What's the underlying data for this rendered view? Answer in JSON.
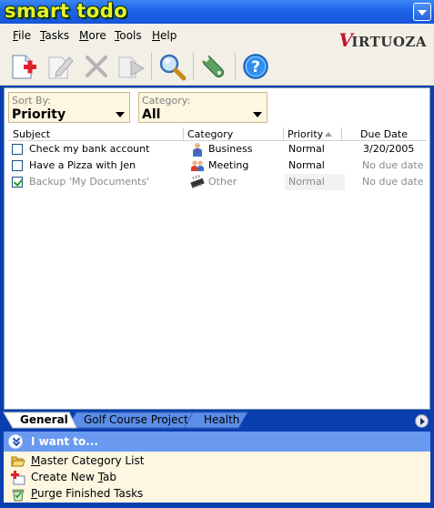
{
  "app": {
    "logo_text": "smart todo",
    "brand": "Virtuoza"
  },
  "menu": [
    {
      "label": "File",
      "mnemonic": "F",
      "rest": "ile"
    },
    {
      "label": "Tasks",
      "mnemonic": "T",
      "rest": "asks"
    },
    {
      "label": "More",
      "mnemonic": "M",
      "rest": "ore"
    },
    {
      "label": "Tools",
      "mnemonic": "T",
      "rest": "ools"
    },
    {
      "label": "Help",
      "mnemonic": "H",
      "rest": "elp"
    }
  ],
  "toolbar": {
    "icons": [
      "new-task-icon",
      "edit-task-icon",
      "delete-task-icon",
      "forward-task-icon",
      "search-icon",
      "tools-icon",
      "help-icon"
    ]
  },
  "filters": {
    "sort_by": {
      "label": "Sort By:",
      "value": "Priority"
    },
    "category": {
      "label": "Category:",
      "value": "All"
    }
  },
  "table": {
    "columns": [
      "Subject",
      "Category",
      "Priority",
      "Due Date"
    ],
    "rows": [
      {
        "checked": false,
        "subject": "Check my bank account",
        "category": "Business",
        "category_icon": "business-person-icon",
        "priority": "Normal",
        "due_date": "3/20/2005",
        "done": false
      },
      {
        "checked": false,
        "subject": "Have a Pizza with Jen",
        "category": "Meeting",
        "category_icon": "meeting-people-icon",
        "priority": "Normal",
        "due_date": "No due date",
        "done": false
      },
      {
        "checked": true,
        "subject": "Backup 'My Documents'",
        "category": "Other",
        "category_icon": "chip-icon",
        "priority": "Normal",
        "due_date": "No due date",
        "done": true
      }
    ]
  },
  "tabs": [
    {
      "label": "General",
      "active": true
    },
    {
      "label": "Golf Course Project",
      "active": false
    },
    {
      "label": "Health",
      "active": false
    }
  ],
  "iwant": {
    "title": "I want to...",
    "actions": [
      {
        "label": "Master Category List",
        "icon": "folder-open-icon",
        "pre": "",
        "mn": "M",
        "post": "aster Category List"
      },
      {
        "label": "Create New Tab",
        "icon": "new-tab-icon",
        "pre": "Create New ",
        "mn": "T",
        "post": "ab"
      },
      {
        "label": "Purge Finished Tasks",
        "icon": "purge-icon",
        "pre": "",
        "mn": "P",
        "post": "urge Finished Tasks"
      }
    ]
  },
  "colors": {
    "titlebar": "#1f63e8",
    "logo": "#e8f22a",
    "panel_bg": "#0a3fb0",
    "filter_bg": "#fdf6e0",
    "iwant_header": "#6a9af0"
  }
}
